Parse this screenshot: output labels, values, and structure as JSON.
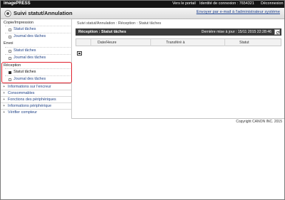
{
  "topbar": {
    "brand": "imagePRESS",
    "portal_link": "Vers le portail",
    "login_id": "Identité de connexion : 7654321",
    "logout_link": "Déconnexion"
  },
  "titlebar": {
    "title": "Suivi statut/Annulation",
    "email_link": "Envoyer par e-mail à l'administrateur système"
  },
  "sidebar": {
    "copy_section": "Copie/Impression",
    "copy_items": [
      "Statut tâches",
      "Journal des tâches"
    ],
    "send_section": "Envoi",
    "send_items": [
      "Statut tâches",
      "Journal des tâches"
    ],
    "receive_section": "Réception",
    "receive_items": [
      "Statut tâches",
      "Journal des tâches"
    ],
    "other_items": [
      "Informations sur l'encreur",
      "Consommables",
      "Fonctions des périphériques",
      "Informations périphérique",
      "Vérifier compteur"
    ]
  },
  "main": {
    "breadcrumb": "Suivi statut/Annulation : Réception : Statut tâches",
    "panel_title": "Réception : Statut tâches",
    "last_update": "Dernière mise à jour : 15/11 2015 22:28:46",
    "columns": [
      "Date/Heure",
      "Transféré à",
      "Statut"
    ]
  },
  "footer": {
    "copyright": "Copyright CANON INC. 2015"
  },
  "colors": {
    "topbar": "#151515",
    "panel_header": "#3b3b3b",
    "highlight": "#e0202c",
    "link": "#224488"
  }
}
